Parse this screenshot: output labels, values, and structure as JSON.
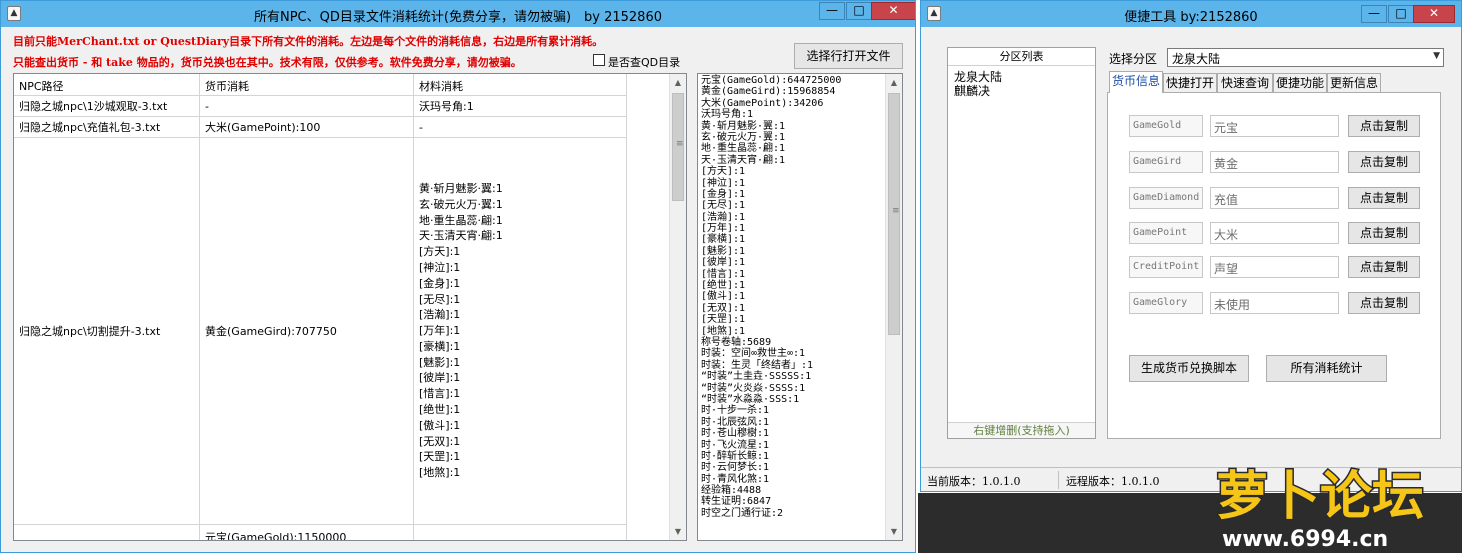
{
  "main_window": {
    "title": "所有NPC、QD目录文件消耗统计(免费分享，请勿被骗)　by 2152860",
    "notice_line1": "目前只能MerChant.txt or QuestDiary目录下所有文件的消耗。左边是每个文件的消耗信息，右边是所有累计消耗。",
    "notice_line2": "只能查出货币 - 和 take 物品的，货币兑换也在其中。技术有限，仅供参考。软件免费分享，请勿被骗。",
    "open_button": "选择行打开文件",
    "qd_checkbox_label": "是否查QD目录",
    "columns": [
      "NPC路径",
      "货币消耗",
      "材料消耗"
    ],
    "rows": [
      {
        "path": "归隐之城npc\\1沙城观取-3.txt",
        "currency": "-",
        "materials": [
          "沃玛号角:1"
        ]
      },
      {
        "path": "归隐之城npc\\充值礼包-3.txt",
        "currency": "大米(GamePoint):100",
        "materials": [
          "-"
        ]
      },
      {
        "path": "归隐之城npc\\切割提升-3.txt",
        "currency": "黄金(GameGird):707750",
        "materials": [
          "黄·斩月魅影·翼:1",
          "玄·破元火万·翼:1",
          "地·重生晶蕊·翩:1",
          "天·玉清天宵·翩:1",
          "[方天]:1",
          "[神泣]:1",
          "[金身]:1",
          "[无尽]:1",
          "[浩瀚]:1",
          "[万年]:1",
          "[豪横]:1",
          "[魅影]:1",
          "[彼岸]:1",
          "[惜言]:1",
          "[绝世]:1",
          "[傲斗]:1",
          "[无双]:1",
          "[天罡]:1",
          "[地煞]:1"
        ]
      },
      {
        "path": "",
        "currency": "元宝(GameGold):1150000",
        "materials": []
      }
    ],
    "totals": [
      "元宝(GameGold):644725000",
      "黄金(GameGird):15968854",
      "大米(GamePoint):34206",
      "沃玛号角:1",
      "黄·斩月魅影·翼:1",
      "玄·破元火万·翼:1",
      "地·重生晶蕊·翩:1",
      "天·玉清天宵·翩:1",
      "[方天]:1",
      "[神泣]:1",
      "[金身]:1",
      "[无尽]:1",
      "[浩瀚]:1",
      "[万年]:1",
      "[豪横]:1",
      "[魅影]:1",
      "[彼岸]:1",
      "[惜言]:1",
      "[绝世]:1",
      "[傲斗]:1",
      "[无双]:1",
      "[天罡]:1",
      "[地煞]:1",
      "称号卷轴:5689",
      "时装：空间∞救世主∞:1",
      "时装：生灵「终结者」:1",
      "“时装”土圭垚·SSSSS:1",
      "“时装”火炎焱·SSSS:1",
      "“时装”水淼淼·SSS:1",
      "时·十步一杀:1",
      "时·北辰弦风:1",
      "时·苍山穆樹:1",
      "时·飞火流星:1",
      "时·醉斩长鲸:1",
      "时·云何梦长:1",
      "时·青风化煞:1",
      "经验箱:4488",
      "转生证明:6847",
      "时空之门通行证:2"
    ]
  },
  "tool_window": {
    "title": "便捷工具 by:2152860",
    "partition_list_title": "分区列表",
    "partitions": [
      "龙泉大陆",
      "麒麟决"
    ],
    "partition_footer": "右键增删(支持拖入)",
    "select_label": "选择分区",
    "selected_partition": "龙泉大陆",
    "tabs": [
      "货币信息",
      "快捷打开",
      "快速查询",
      "便捷功能",
      "更新信息"
    ],
    "currencies": [
      {
        "key": "GameGold",
        "name": "元宝",
        "button": "点击复制"
      },
      {
        "key": "GameGird",
        "name": "黄金",
        "button": "点击复制"
      },
      {
        "key": "GameDiamond",
        "name": "充值",
        "button": "点击复制"
      },
      {
        "key": "GamePoint",
        "name": "大米",
        "button": "点击复制"
      },
      {
        "key": "CreditPoint",
        "name": "声望",
        "button": "点击复制"
      },
      {
        "key": "GameGlory",
        "name": "未使用",
        "button": "点击复制"
      }
    ],
    "gen_script_button": "生成货币兑换脚本",
    "all_stats_button": "所有消耗统计",
    "current_version": "当前版本：1.0.1.0",
    "remote_version": "远程版本：1.0.1.0"
  },
  "watermark": {
    "site_name": "萝卜论坛",
    "url": "www.6994.cn"
  }
}
